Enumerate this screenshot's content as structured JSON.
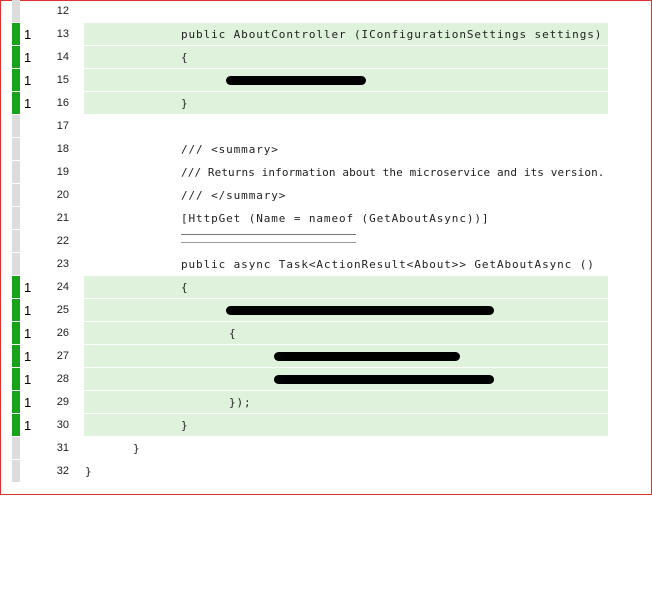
{
  "lines": [
    {
      "num": "12",
      "count": "",
      "changed": false,
      "code": ""
    },
    {
      "num": "13",
      "count": "1",
      "changed": true,
      "code": "public AboutController (IConfigurationSettings settings)"
    },
    {
      "num": "14",
      "count": "1",
      "changed": true,
      "code": "{"
    },
    {
      "num": "15",
      "count": "1",
      "changed": true,
      "code": ""
    },
    {
      "num": "16",
      "count": "1",
      "changed": true,
      "code": "}"
    },
    {
      "num": "17",
      "count": "",
      "changed": false,
      "code": ""
    },
    {
      "num": "18",
      "count": "",
      "changed": false,
      "code": "/// <summary>"
    },
    {
      "num": "19",
      "count": "",
      "changed": false,
      "code": "/// Returns information about the microservice and its version."
    },
    {
      "num": "20",
      "count": "",
      "changed": false,
      "code": "/// </summary>"
    },
    {
      "num": "21",
      "count": "",
      "changed": false,
      "code": "[HttpGet (Name = nameof (GetAboutAsync))]"
    },
    {
      "num": "22",
      "count": "",
      "changed": false,
      "code": ""
    },
    {
      "num": "23",
      "count": "",
      "changed": false,
      "code": "public async Task<ActionResult<About>> GetAboutAsync ()"
    },
    {
      "num": "24",
      "count": "1",
      "changed": true,
      "code": "{"
    },
    {
      "num": "25",
      "count": "1",
      "changed": true,
      "code": ""
    },
    {
      "num": "26",
      "count": "1",
      "changed": true,
      "code": "{"
    },
    {
      "num": "27",
      "count": "1",
      "changed": true,
      "code": ""
    },
    {
      "num": "28",
      "count": "1",
      "changed": true,
      "code": ""
    },
    {
      "num": "29",
      "count": "1",
      "changed": true,
      "code": "});"
    },
    {
      "num": "30",
      "count": "1",
      "changed": true,
      "code": "}"
    },
    {
      "num": "31",
      "count": "",
      "changed": false,
      "code": "}"
    },
    {
      "num": "32",
      "count": "",
      "changed": false,
      "code": "}"
    }
  ],
  "colors": {
    "changed_marker": "#19a319",
    "unchanged_marker": "#dcdcdc",
    "changed_background": "#dff2dc",
    "frame_border": "#e03030"
  }
}
